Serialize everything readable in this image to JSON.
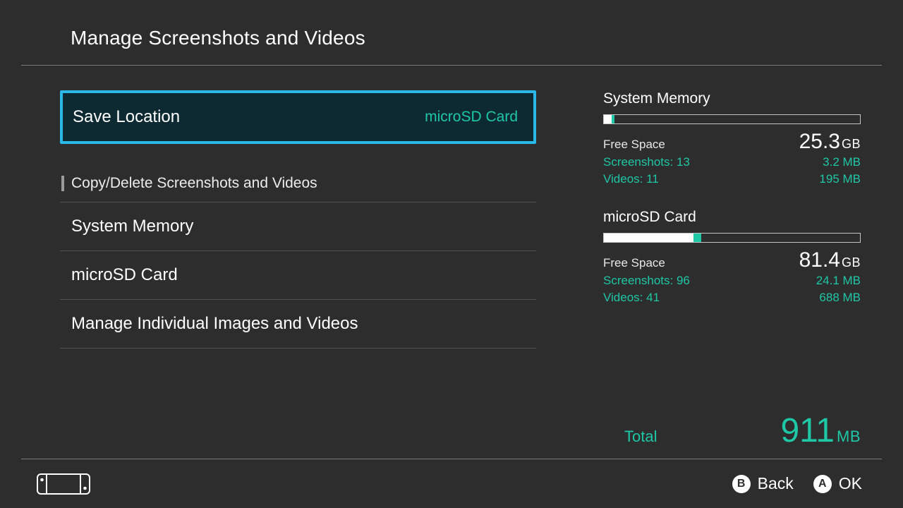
{
  "header": {
    "title": "Manage Screenshots and Videos"
  },
  "saveLocation": {
    "label": "Save Location",
    "value": "microSD Card"
  },
  "section": {
    "title": "Copy/Delete Screenshots and Videos"
  },
  "listItems": {
    "systemMemory": "System Memory",
    "microSD": "microSD Card",
    "manageIndividual": "Manage Individual Images and Videos"
  },
  "storage": {
    "systemMemory": {
      "title": "System Memory",
      "fillPercent": 3,
      "accentPercent": 1,
      "freeLabel": "Free Space",
      "freeValue": "25.3",
      "freeUnit": "GB",
      "screenshotsLabel": "Screenshots: 13",
      "screenshotsValue": "3.2 MB",
      "videosLabel": "Videos: 11",
      "videosValue": "195 MB"
    },
    "microSD": {
      "title": "microSD Card",
      "fillPercent": 35,
      "accentPercent": 3,
      "freeLabel": "Free Space",
      "freeValue": "81.4",
      "freeUnit": "GB",
      "screenshotsLabel": "Screenshots: 96",
      "screenshotsValue": "24.1 MB",
      "videosLabel": "Videos: 41",
      "videosValue": "688 MB"
    }
  },
  "total": {
    "label": "Total",
    "value": "911",
    "unit": "MB"
  },
  "footer": {
    "back": {
      "button": "B",
      "label": "Back"
    },
    "ok": {
      "button": "A",
      "label": "OK"
    }
  }
}
